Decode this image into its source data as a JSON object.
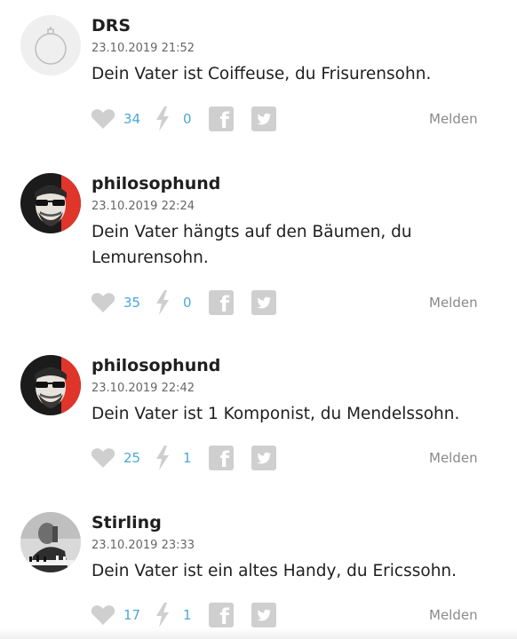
{
  "colors": {
    "count": "#4aa8d8",
    "icon": "#cfcfcf",
    "report": "#8a8a8a"
  },
  "comments": [
    {
      "author": "DRS",
      "date": "23.10.2019 21:52",
      "text": "Dein Vater ist Coiffeuse, du Frisurensohn.",
      "likes": "34",
      "flashes": "0",
      "report": "Melden",
      "avatar": "default-avatar-icon"
    },
    {
      "author": "philosophund",
      "date": "23.10.2019 22:24",
      "text": "Dein Vater hängts auf den Bäumen, du Lemurensohn.",
      "likes": "35",
      "flashes": "0",
      "report": "Melden",
      "avatar": "philosophund-avatar"
    },
    {
      "author": "philosophund",
      "date": "23.10.2019 22:42",
      "text": "Dein Vater ist 1 Komponist, du Mendelssohn.",
      "likes": "25",
      "flashes": "1",
      "report": "Melden",
      "avatar": "philosophund-avatar"
    },
    {
      "author": "Stirling",
      "date": "23.10.2019 23:33",
      "text": "Dein Vater ist ein altes Handy, du Ericssohn.",
      "likes": "17",
      "flashes": "1",
      "report": "Melden",
      "avatar": "stirling-avatar"
    }
  ],
  "icons": {
    "facebook_glyph": "f"
  }
}
